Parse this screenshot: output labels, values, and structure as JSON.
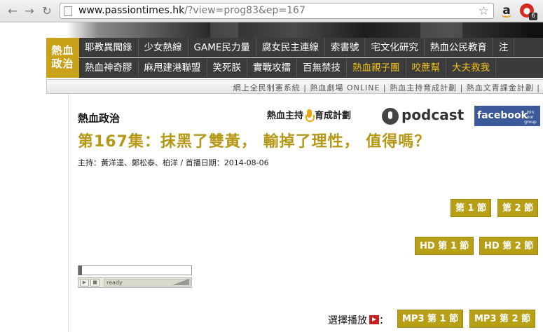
{
  "browser": {
    "url_host": "www.passiontimes.hk",
    "url_path": "/?view=prog83&ep=167",
    "back_icon": "back-arrow-icon",
    "forward_icon": "forward-arrow-icon",
    "reload_icon": "reload-icon",
    "extension_badge": "6"
  },
  "site": {
    "logo_line1": "熱血",
    "logo_line2": "政治",
    "menu_row1": [
      "耶教異聞錄",
      "少女熱線",
      "GAME民力量",
      "腐女民主連線",
      "索書號",
      "宅文化研究",
      "熱血公民教育",
      "注"
    ],
    "menu_row2": [
      {
        "label": "熱血神奇膠",
        "gold": false
      },
      {
        "label": "麻甩建港聯盟",
        "gold": false
      },
      {
        "label": "笑死朕",
        "gold": false
      },
      {
        "label": "實戰攻擂",
        "gold": false
      },
      {
        "label": "百無禁技",
        "gold": false
      },
      {
        "label": "熱血親子團",
        "gold": true
      },
      {
        "label": "咬蔗幫",
        "gold": true
      },
      {
        "label": "大夫救我",
        "gold": true
      }
    ],
    "subnav": "網上全民制憲系統 | 熱血劇場 ONLINE | 熱血主持育成計劃 | 熱血文青課金計劃 |"
  },
  "page": {
    "section_title": "熱血政治",
    "host_logo_left": "熱血主持",
    "host_logo_right": "育成計劃",
    "podcast": "podcast",
    "facebook": "facebook",
    "facebook_join": "join our group »",
    "episode_title": "第167集：抹黑了雙黃， 輸掉了理性， 值得嗎？",
    "meta": "主持：黃洋達、鄭松泰、柏洋 / 首播日期：2014-08-06",
    "btn_seg1": "第 1 節",
    "btn_seg2": "第 2 節",
    "btn_hd1": "HD 第 1 節",
    "btn_hd2": "HD 第 2 節",
    "player_status": "ready",
    "choose_label": "選擇播放",
    "choose_colon": "：",
    "btn_mp3_1": "MP3 第 1 節",
    "btn_mp3_2": "MP3 第 2 節"
  },
  "colors": {
    "accent_gold": "#b8a016",
    "menu_bg": "#3b3b3b",
    "facebook_blue": "#3b5998"
  }
}
